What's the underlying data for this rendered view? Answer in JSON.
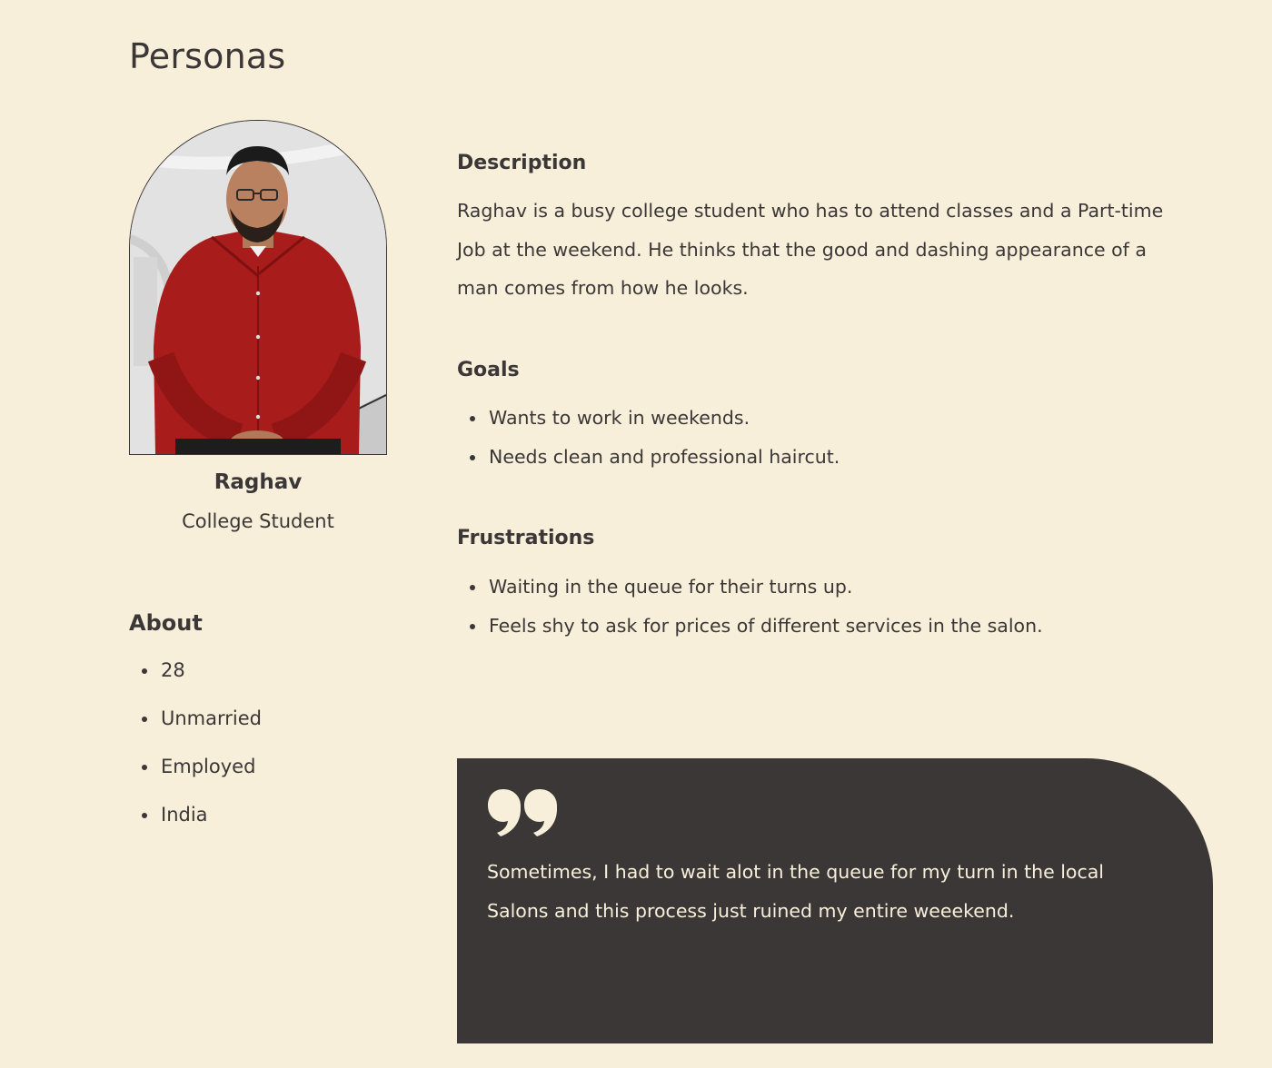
{
  "page": {
    "title": "Personas"
  },
  "persona": {
    "name": "Raghav",
    "role": "College Student",
    "photo_icon": "portrait-photo-man-red-shirt"
  },
  "about": {
    "heading": "About",
    "items": [
      "28",
      "Unmarried",
      "Employed",
      "India"
    ]
  },
  "description": {
    "heading": "Description",
    "text": "Raghav is a busy college student who has to attend classes and a Part-time Job at the weekend. He thinks that the good and dashing appearance of a man comes from how he looks."
  },
  "goals": {
    "heading": "Goals",
    "items": [
      "Wants to work in weekends.",
      "Needs clean and professional haircut."
    ]
  },
  "frustrations": {
    "heading": "Frustrations",
    "items": [
      "Waiting in the queue for their turns up.",
      "Feels shy to ask for prices of different services in the salon."
    ]
  },
  "quote": {
    "icon": "quote-icon",
    "text": "Sometimes, I had to wait alot in the queue for my turn in the local Salons and this process just ruined my entire weeekend."
  },
  "colors": {
    "background": "#f8efda",
    "text": "#3b3737",
    "card": "#3b3737",
    "card_text": "#f8efda"
  }
}
